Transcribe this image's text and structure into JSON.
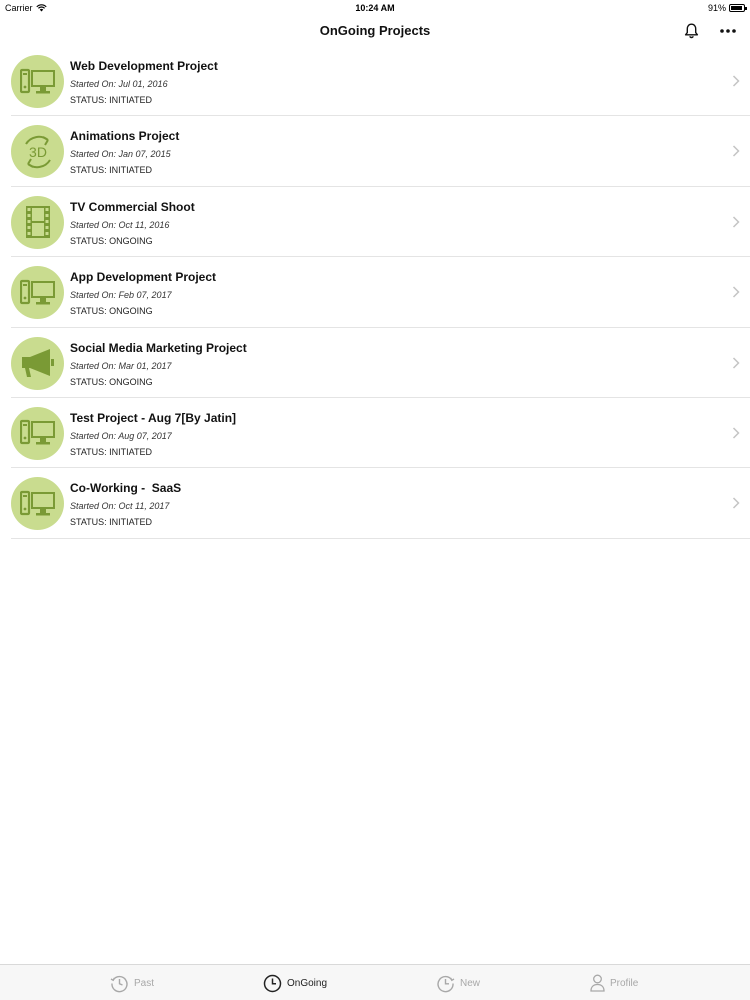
{
  "status_bar": {
    "carrier": "Carrier",
    "time": "10:24 AM",
    "battery": "91%"
  },
  "nav": {
    "title": "OnGoing Projects",
    "bell_icon": "bell-icon",
    "more_icon": "more-horizontal-icon"
  },
  "colors": {
    "avatar_bg": "#c9dc8f",
    "avatar_icon": "#7a9a35",
    "active_tab": "#222222",
    "inactive_tab": "#a8a8a8"
  },
  "projects": [
    {
      "name": "Web Development Project",
      "started_label": "Started On: ",
      "started_date": "Jul 01, 2016",
      "status": "STATUS: INITIATED",
      "icon": "desktop-computer-icon"
    },
    {
      "name": "Animations Project",
      "started_label": "Started On: ",
      "started_date": "Jan 07, 2015",
      "status": "STATUS: INITIATED",
      "icon": "3d-rotate-icon"
    },
    {
      "name": "TV Commercial Shoot",
      "started_label": "Started On: ",
      "started_date": "Oct 11, 2016",
      "status": "STATUS: ONGOING",
      "icon": "film-strip-icon"
    },
    {
      "name": "App Development Project",
      "started_label": "Started On: ",
      "started_date": "Feb 07, 2017",
      "status": "STATUS: ONGOING",
      "icon": "desktop-computer-icon"
    },
    {
      "name": "Social Media Marketing Project",
      "started_label": "Started On: ",
      "started_date": "Mar 01, 2017",
      "status": "STATUS: ONGOING",
      "icon": "megaphone-icon"
    },
    {
      "name": "Test Project - Aug 7[By Jatin]",
      "started_label": "Started On: ",
      "started_date": "Aug 07, 2017",
      "status": "STATUS: INITIATED",
      "icon": "desktop-computer-icon"
    },
    {
      "name": "Co-Working -  SaaS",
      "started_label": "Started On: ",
      "started_date": "Oct 11, 2017",
      "status": "STATUS: INITIATED",
      "icon": "desktop-computer-icon"
    }
  ],
  "tabs": [
    {
      "label": "Past",
      "icon": "history-clock-icon",
      "active": false
    },
    {
      "label": "OnGoing",
      "icon": "clock-icon",
      "active": true
    },
    {
      "label": "New",
      "icon": "clock-forward-icon",
      "active": false
    },
    {
      "label": "Profile",
      "icon": "person-icon",
      "active": false
    }
  ]
}
